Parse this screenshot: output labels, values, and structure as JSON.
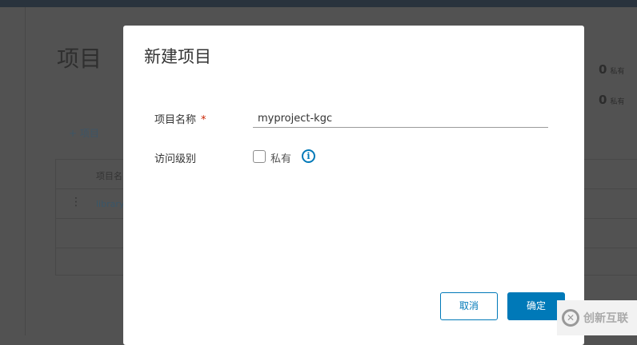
{
  "background": {
    "page_title": "项目",
    "add_project": "+ 项目",
    "stats": [
      {
        "count": "0",
        "label": "私有"
      },
      {
        "count": "0",
        "label": "私有"
      }
    ],
    "table_header": "项目名",
    "rows": [
      "library"
    ]
  },
  "modal": {
    "title": "新建项目",
    "name_label": "项目名称",
    "required_mark": "*",
    "name_value": "myproject-kgc",
    "access_label": "访问级别",
    "private_label": "私有",
    "info_icon": "i",
    "cancel": "取消",
    "confirm": "确定"
  },
  "watermark": {
    "text": "创新互联"
  },
  "colors": {
    "accent": "#0079b8"
  }
}
